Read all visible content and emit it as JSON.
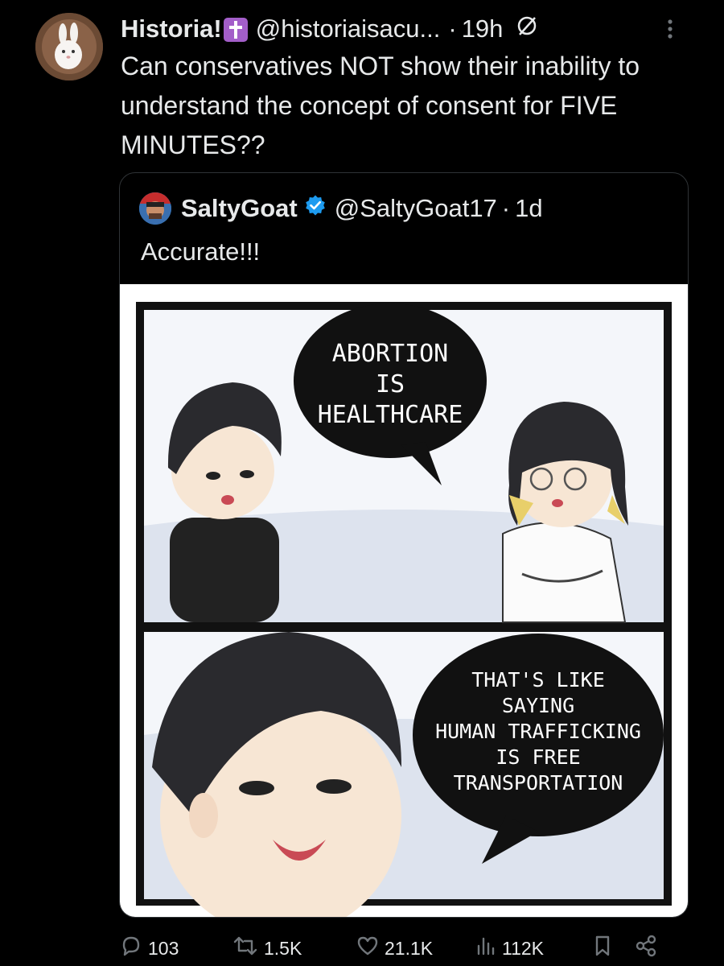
{
  "tweet": {
    "display_name": "Historia!",
    "handle": "@historiaisacu...",
    "separator": "·",
    "time": "19h",
    "text": "Can conservatives NOT show their inability to understand the concept of consent for FIVE MINUTES??"
  },
  "quote": {
    "display_name": "SaltyGoat",
    "handle": "@SaltyGoat17",
    "separator": "·",
    "time": "1d",
    "text": "Accurate!!!",
    "comic": {
      "panel1_bubble": [
        "ABORTION",
        "IS",
        "HEALTHCARE"
      ],
      "panel2_bubble": [
        "THAT'S LIKE",
        "SAYING",
        "HUMAN TRAFFICKING",
        "IS FREE",
        "TRANSPORTATION"
      ]
    }
  },
  "actions": {
    "replies": "103",
    "reposts": "1.5K",
    "likes": "21.1K",
    "views": "112K"
  },
  "icons": [
    "grok-icon",
    "more-icon",
    "verified-icon",
    "reply-icon",
    "repost-icon",
    "like-icon",
    "views-icon",
    "bookmark-icon",
    "share-icon"
  ],
  "colors": {
    "background": "#000000",
    "text": "#e7e9ea",
    "verified": "#1d9bf0",
    "badge": "#a35ec9"
  }
}
